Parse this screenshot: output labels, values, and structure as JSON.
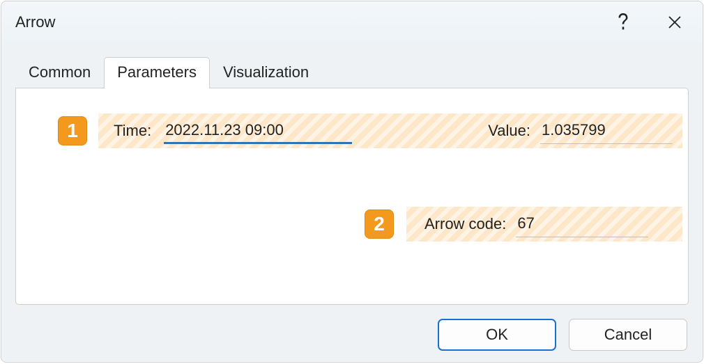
{
  "dialog": {
    "title": "Arrow"
  },
  "tabs": {
    "common": "Common",
    "parameters": "Parameters",
    "visualization": "Visualization",
    "active": "parameters"
  },
  "annotations": {
    "badge1": "1",
    "badge2": "2"
  },
  "fields": {
    "time_label": "Time:",
    "time_value": "2022.11.23 09:00",
    "value_label": "Value:",
    "value_value": "1.035799",
    "arrow_code_label": "Arrow code:",
    "arrow_code_value": "67"
  },
  "buttons": {
    "ok": "OK",
    "cancel": "Cancel"
  },
  "colors": {
    "highlight": "#fde7c8",
    "badge": "#f39a1e",
    "accent": "#1a6fd6",
    "focus_underline": "#2f72b8"
  }
}
